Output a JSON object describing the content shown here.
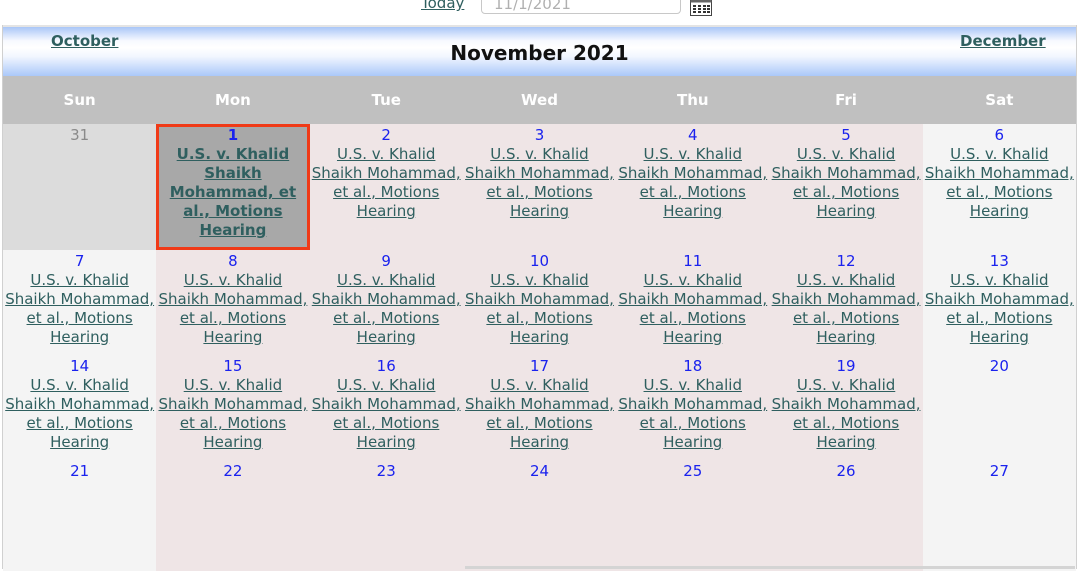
{
  "toolbar": {
    "today_label": "Today",
    "date_value": "11/1/2021",
    "calendar_icon": "calendar-grid-icon"
  },
  "calendar": {
    "prev_month": "October",
    "next_month": "December",
    "title": "November 2021",
    "days_of_week": [
      "Sun",
      "Mon",
      "Tue",
      "Wed",
      "Thu",
      "Fri",
      "Sat"
    ],
    "weeks": [
      [
        {
          "day": "31",
          "event": "",
          "type": "other"
        },
        {
          "day": "1",
          "event": "U.S. v. Khalid Shaikh Mohammad, et al., Motions Hearing",
          "type": "selected"
        },
        {
          "day": "2",
          "event": "U.S. v. Khalid Shaikh Mohammad, et al., Motions Hearing",
          "type": "wkday"
        },
        {
          "day": "3",
          "event": "U.S. v. Khalid Shaikh Mohammad, et al., Motions Hearing",
          "type": "wkday"
        },
        {
          "day": "4",
          "event": "U.S. v. Khalid Shaikh Mohammad, et al., Motions Hearing",
          "type": "wkday"
        },
        {
          "day": "5",
          "event": "U.S. v. Khalid Shaikh Mohammad, et al., Motions Hearing",
          "type": "wkday"
        },
        {
          "day": "6",
          "event": "U.S. v. Khalid Shaikh Mohammad, et al., Motions Hearing",
          "type": "wkend"
        }
      ],
      [
        {
          "day": "7",
          "event": "U.S. v. Khalid Shaikh Mohammad, et al., Motions Hearing",
          "type": "wkend"
        },
        {
          "day": "8",
          "event": "U.S. v. Khalid Shaikh Mohammad, et al., Motions Hearing",
          "type": "wkday"
        },
        {
          "day": "9",
          "event": "U.S. v. Khalid Shaikh Mohammad, et al., Motions Hearing",
          "type": "wkday"
        },
        {
          "day": "10",
          "event": "U.S. v. Khalid Shaikh Mohammad, et al., Motions Hearing",
          "type": "wkday"
        },
        {
          "day": "11",
          "event": "U.S. v. Khalid Shaikh Mohammad, et al., Motions Hearing",
          "type": "wkday"
        },
        {
          "day": "12",
          "event": "U.S. v. Khalid Shaikh Mohammad, et al., Motions Hearing",
          "type": "wkday"
        },
        {
          "day": "13",
          "event": "U.S. v. Khalid Shaikh Mohammad, et al., Motions Hearing",
          "type": "wkend"
        }
      ],
      [
        {
          "day": "14",
          "event": "U.S. v. Khalid Shaikh Mohammad, et al., Motions Hearing",
          "type": "wkend"
        },
        {
          "day": "15",
          "event": "U.S. v. Khalid Shaikh Mohammad, et al., Motions Hearing",
          "type": "wkday"
        },
        {
          "day": "16",
          "event": "U.S. v. Khalid Shaikh Mohammad, et al., Motions Hearing",
          "type": "wkday"
        },
        {
          "day": "17",
          "event": "U.S. v. Khalid Shaikh Mohammad, et al., Motions Hearing",
          "type": "wkday"
        },
        {
          "day": "18",
          "event": "U.S. v. Khalid Shaikh Mohammad, et al., Motions Hearing",
          "type": "wkday"
        },
        {
          "day": "19",
          "event": "U.S. v. Khalid Shaikh Mohammad, et al., Motions Hearing",
          "type": "wkday"
        },
        {
          "day": "20",
          "event": "",
          "type": "wkend"
        }
      ],
      [
        {
          "day": "21",
          "event": "",
          "type": "wkend"
        },
        {
          "day": "22",
          "event": "",
          "type": "wkday"
        },
        {
          "day": "23",
          "event": "",
          "type": "wkday"
        },
        {
          "day": "24",
          "event": "",
          "type": "wkday"
        },
        {
          "day": "25",
          "event": "",
          "type": "wkday"
        },
        {
          "day": "26",
          "event": "",
          "type": "wkday"
        },
        {
          "day": "27",
          "event": "",
          "type": "wkend"
        }
      ]
    ]
  }
}
